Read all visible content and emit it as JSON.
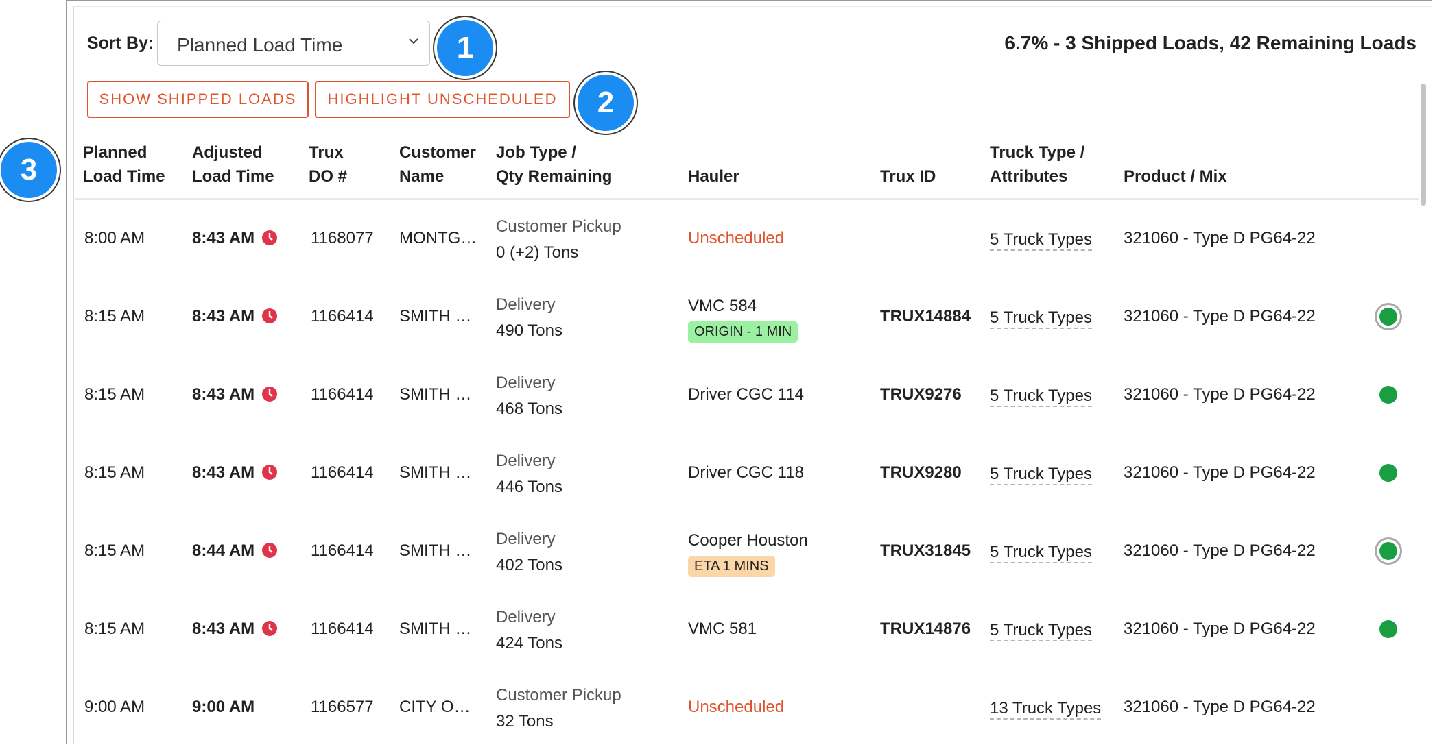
{
  "sort": {
    "label": "Sort By:",
    "selected": "Planned Load Time"
  },
  "summary": "6.7% - 3 Shipped Loads, 42 Remaining Loads",
  "buttons": {
    "show_shipped": "SHOW SHIPPED LOADS",
    "highlight_unscheduled": "HIGHLIGHT UNSCHEDULED"
  },
  "callouts": [
    "1",
    "2",
    "3"
  ],
  "columns": {
    "planned": [
      "Planned",
      "Load Time"
    ],
    "adjusted": [
      "Adjusted",
      "Load Time"
    ],
    "do": [
      "Trux",
      "DO #"
    ],
    "customer": [
      "Customer",
      "Name"
    ],
    "job": [
      "Job Type /",
      "Qty Remaining"
    ],
    "hauler": "Hauler",
    "truxid": "Trux ID",
    "trucktype": [
      "Truck Type /",
      "Attributes"
    ],
    "product": "Product / Mix"
  },
  "rows": [
    {
      "planned": "8:00 AM",
      "adjusted": "8:43 AM",
      "late": true,
      "do": "1168077",
      "customer": "MONTG…",
      "job": "Customer Pickup",
      "qty": "0 (+2) Tons",
      "hauler": "Unscheduled",
      "hauler_status": "unscheduled",
      "badge": "",
      "badge_type": "",
      "truxid": "",
      "truck_types": "5 Truck Types",
      "product": "321060 - Type D PG64-22",
      "status_dot": "none"
    },
    {
      "planned": "8:15 AM",
      "adjusted": "8:43 AM",
      "late": true,
      "do": "1166414",
      "customer": "SMITH …",
      "job": "Delivery",
      "qty": "490 Tons",
      "hauler": "VMC 584",
      "hauler_status": "assigned",
      "badge": "ORIGIN - 1 MIN",
      "badge_type": "green",
      "truxid": "TRUX14884",
      "truck_types": "5 Truck Types",
      "product": "321060 - Type D PG64-22",
      "status_dot": "ring"
    },
    {
      "planned": "8:15 AM",
      "adjusted": "8:43 AM",
      "late": true,
      "do": "1166414",
      "customer": "SMITH …",
      "job": "Delivery",
      "qty": "468 Tons",
      "hauler": "Driver CGC 114",
      "hauler_status": "assigned",
      "badge": "",
      "badge_type": "",
      "truxid": "TRUX9276",
      "truck_types": "5 Truck Types",
      "product": "321060 - Type D PG64-22",
      "status_dot": "dot"
    },
    {
      "planned": "8:15 AM",
      "adjusted": "8:43 AM",
      "late": true,
      "do": "1166414",
      "customer": "SMITH …",
      "job": "Delivery",
      "qty": "446 Tons",
      "hauler": "Driver CGC 118",
      "hauler_status": "assigned",
      "badge": "",
      "badge_type": "",
      "truxid": "TRUX9280",
      "truck_types": "5 Truck Types",
      "product": "321060 - Type D PG64-22",
      "status_dot": "dot"
    },
    {
      "planned": "8:15 AM",
      "adjusted": "8:44 AM",
      "late": true,
      "do": "1166414",
      "customer": "SMITH …",
      "job": "Delivery",
      "qty": "402 Tons",
      "hauler": "Cooper Houston",
      "hauler_status": "assigned",
      "badge": "ETA 1 MINS",
      "badge_type": "amber",
      "truxid": "TRUX31845",
      "truck_types": "5 Truck Types",
      "product": "321060 - Type D PG64-22",
      "status_dot": "ring"
    },
    {
      "planned": "8:15 AM",
      "adjusted": "8:43 AM",
      "late": true,
      "do": "1166414",
      "customer": "SMITH …",
      "job": "Delivery",
      "qty": "424 Tons",
      "hauler": "VMC 581",
      "hauler_status": "assigned",
      "badge": "",
      "badge_type": "",
      "truxid": "TRUX14876",
      "truck_types": "5 Truck Types",
      "product": "321060 - Type D PG64-22",
      "status_dot": "dot"
    },
    {
      "planned": "9:00 AM",
      "adjusted": "9:00 AM",
      "late": false,
      "do": "1166577",
      "customer": "CITY O…",
      "job": "Customer Pickup",
      "qty": "32 Tons",
      "hauler": "Unscheduled",
      "hauler_status": "unscheduled",
      "badge": "",
      "badge_type": "",
      "truxid": "",
      "truck_types": "13 Truck Types",
      "product": "321060 - Type D PG64-22",
      "status_dot": "none"
    }
  ],
  "colors": {
    "accent": "#e0542d",
    "callout": "#1a8cf2",
    "status_green": "#1a9e44",
    "late_red": "#e0344a"
  }
}
